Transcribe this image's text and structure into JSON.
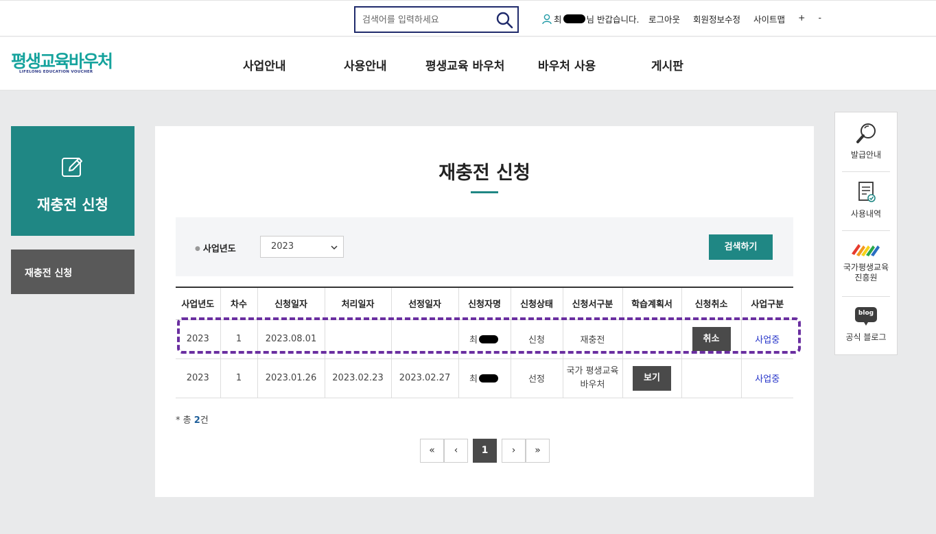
{
  "search": {
    "placeholder": "검색어를 입력하세요"
  },
  "user": {
    "name_prefix": "최",
    "greeting": "님 반갑습니다."
  },
  "util_links": [
    "로그아웃",
    "회원정보수정",
    "사이트맵",
    "+",
    "-"
  ],
  "logo": {
    "main": "평생교육바우처",
    "sub": "LIFELONG EDUCATION VOUCHER"
  },
  "nav": [
    "사업안내",
    "사용안내",
    "평생교육 바우처",
    "바우처 사용",
    "게시판"
  ],
  "sidebar": {
    "title": "재충전 신청",
    "menu_item": "재충전 신청"
  },
  "page": {
    "title": "재충전 신청"
  },
  "filter": {
    "label": "사업년도",
    "year": "2023",
    "search_button": "검색하기"
  },
  "table": {
    "headers": [
      "사업년도",
      "차수",
      "신청일자",
      "처리일자",
      "선정일자",
      "신청자명",
      "신청상태",
      "신청서구분",
      "학습계획서",
      "신청취소",
      "사업구분"
    ],
    "rows": [
      {
        "year": "2023",
        "round": "1",
        "apply_date": "2023.08.01",
        "process_date": "",
        "select_date": "",
        "name": "최",
        "status": "신청",
        "type": "재충전",
        "plan": "",
        "cancel": "취소",
        "category": "사업중"
      },
      {
        "year": "2023",
        "round": "1",
        "apply_date": "2023.01.26",
        "process_date": "2023.02.23",
        "select_date": "2023.02.27",
        "name": "최",
        "status": "선정",
        "type": "국가 평생교육 바우처",
        "plan": "보기",
        "cancel": "",
        "category": "사업중"
      }
    ]
  },
  "total": {
    "prefix": "* 총 ",
    "count": "2",
    "suffix": "건"
  },
  "pager": {
    "first": "«",
    "prev": "‹",
    "current": "1",
    "next": "›",
    "last": "»"
  },
  "quick_menu": [
    {
      "label": "발급안내",
      "icon": "magnifier-icon"
    },
    {
      "label": "사용내역",
      "icon": "document-check-icon"
    },
    {
      "label": "국가평생교육\n진흥원",
      "icon": "nile-logo-icon"
    },
    {
      "label": "공식 블로그",
      "icon": "blog-icon",
      "badge": "blog"
    }
  ],
  "colors": {
    "brand": "#1f8784",
    "dark_button": "#4a4a4a",
    "highlight": "#6a2fa0",
    "link": "#2433c9"
  }
}
